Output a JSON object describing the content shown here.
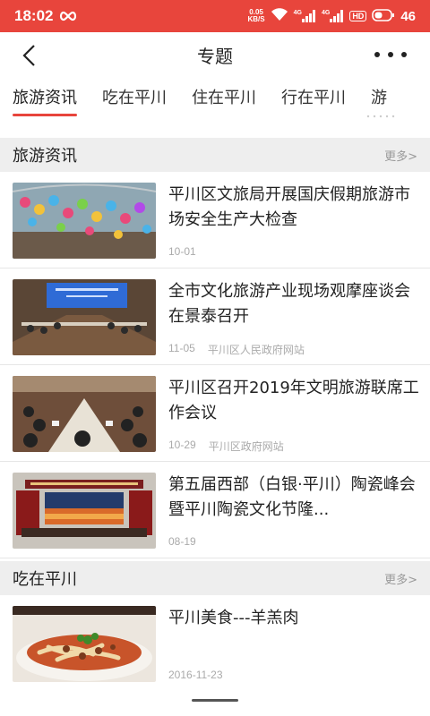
{
  "status_bar": {
    "time": "18:02",
    "net_speed_value": "0.05",
    "net_speed_unit": "KB/S",
    "network_1": "4G",
    "network_2": "4G",
    "hd_label": "HD",
    "battery": "46"
  },
  "nav": {
    "title": "专题"
  },
  "tabs": [
    {
      "label": "旅游资讯",
      "active": true
    },
    {
      "label": "吃在平川",
      "active": false
    },
    {
      "label": "住在平川",
      "active": false
    },
    {
      "label": "行在平川",
      "active": false
    },
    {
      "label": "游",
      "active": false
    }
  ],
  "sections": [
    {
      "title": "旅游资讯",
      "more": "更多>",
      "items": [
        {
          "title": "平川区文旅局开展国庆假期旅游市场安全生产大检查",
          "date": "10-01",
          "source": ""
        },
        {
          "title": "全市文化旅游产业现场观摩座谈会在景泰召开",
          "date": "11-05",
          "source": "平川区人民政府网站"
        },
        {
          "title": "平川区召开2019年文明旅游联席工作会议",
          "date": "10-29",
          "source": "平川区政府网站"
        },
        {
          "title": "第五届西部（白银·平川）陶瓷峰会暨平川陶瓷文化节隆...",
          "date": "08-19",
          "source": ""
        }
      ]
    },
    {
      "title": "吃在平川",
      "more": "更多>",
      "items": [
        {
          "title": "平川美食---羊羔肉",
          "date": "2016-11-23",
          "source": ""
        }
      ]
    }
  ],
  "colors": {
    "accent": "#e8453c",
    "section_bg": "#eeeeee",
    "meta": "#aaaaaa"
  }
}
